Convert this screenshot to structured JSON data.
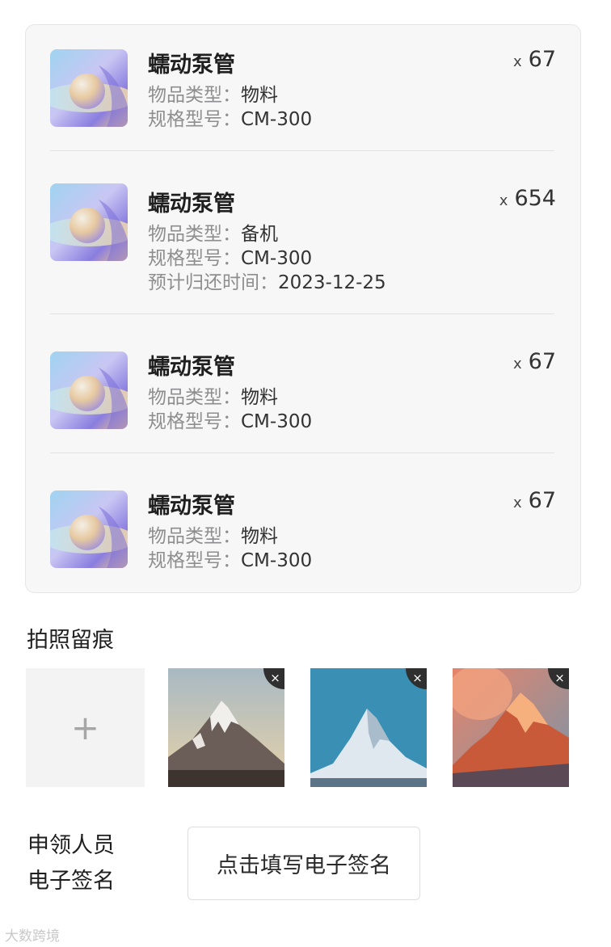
{
  "items": [
    {
      "name": "蠕动泵管",
      "qty_prefix": "x",
      "qty": "67",
      "type_label": "物品类型：",
      "type_value": "物料",
      "model_label": "规格型号：",
      "model_value": "CM-300"
    },
    {
      "name": "蠕动泵管",
      "qty_prefix": "x",
      "qty": "654",
      "type_label": "物品类型：",
      "type_value": "备机",
      "model_label": "规格型号：",
      "model_value": "CM-300",
      "return_label": "预计归还时间：",
      "return_value": "2023-12-25"
    },
    {
      "name": "蠕动泵管",
      "qty_prefix": "x",
      "qty": "67",
      "type_label": "物品类型：",
      "type_value": "物料",
      "model_label": "规格型号：",
      "model_value": "CM-300"
    },
    {
      "name": "蠕动泵管",
      "qty_prefix": "x",
      "qty": "67",
      "type_label": "物品类型：",
      "type_value": "物料",
      "model_label": "规格型号：",
      "model_value": "CM-300"
    }
  ],
  "photos": {
    "title": "拍照留痕",
    "add_icon": "+",
    "remove_icon": "×"
  },
  "signature": {
    "label_line1": "申领人员",
    "label_line2": "电子签名",
    "button_label": "点击填写电子签名"
  },
  "watermark": "大数跨境"
}
